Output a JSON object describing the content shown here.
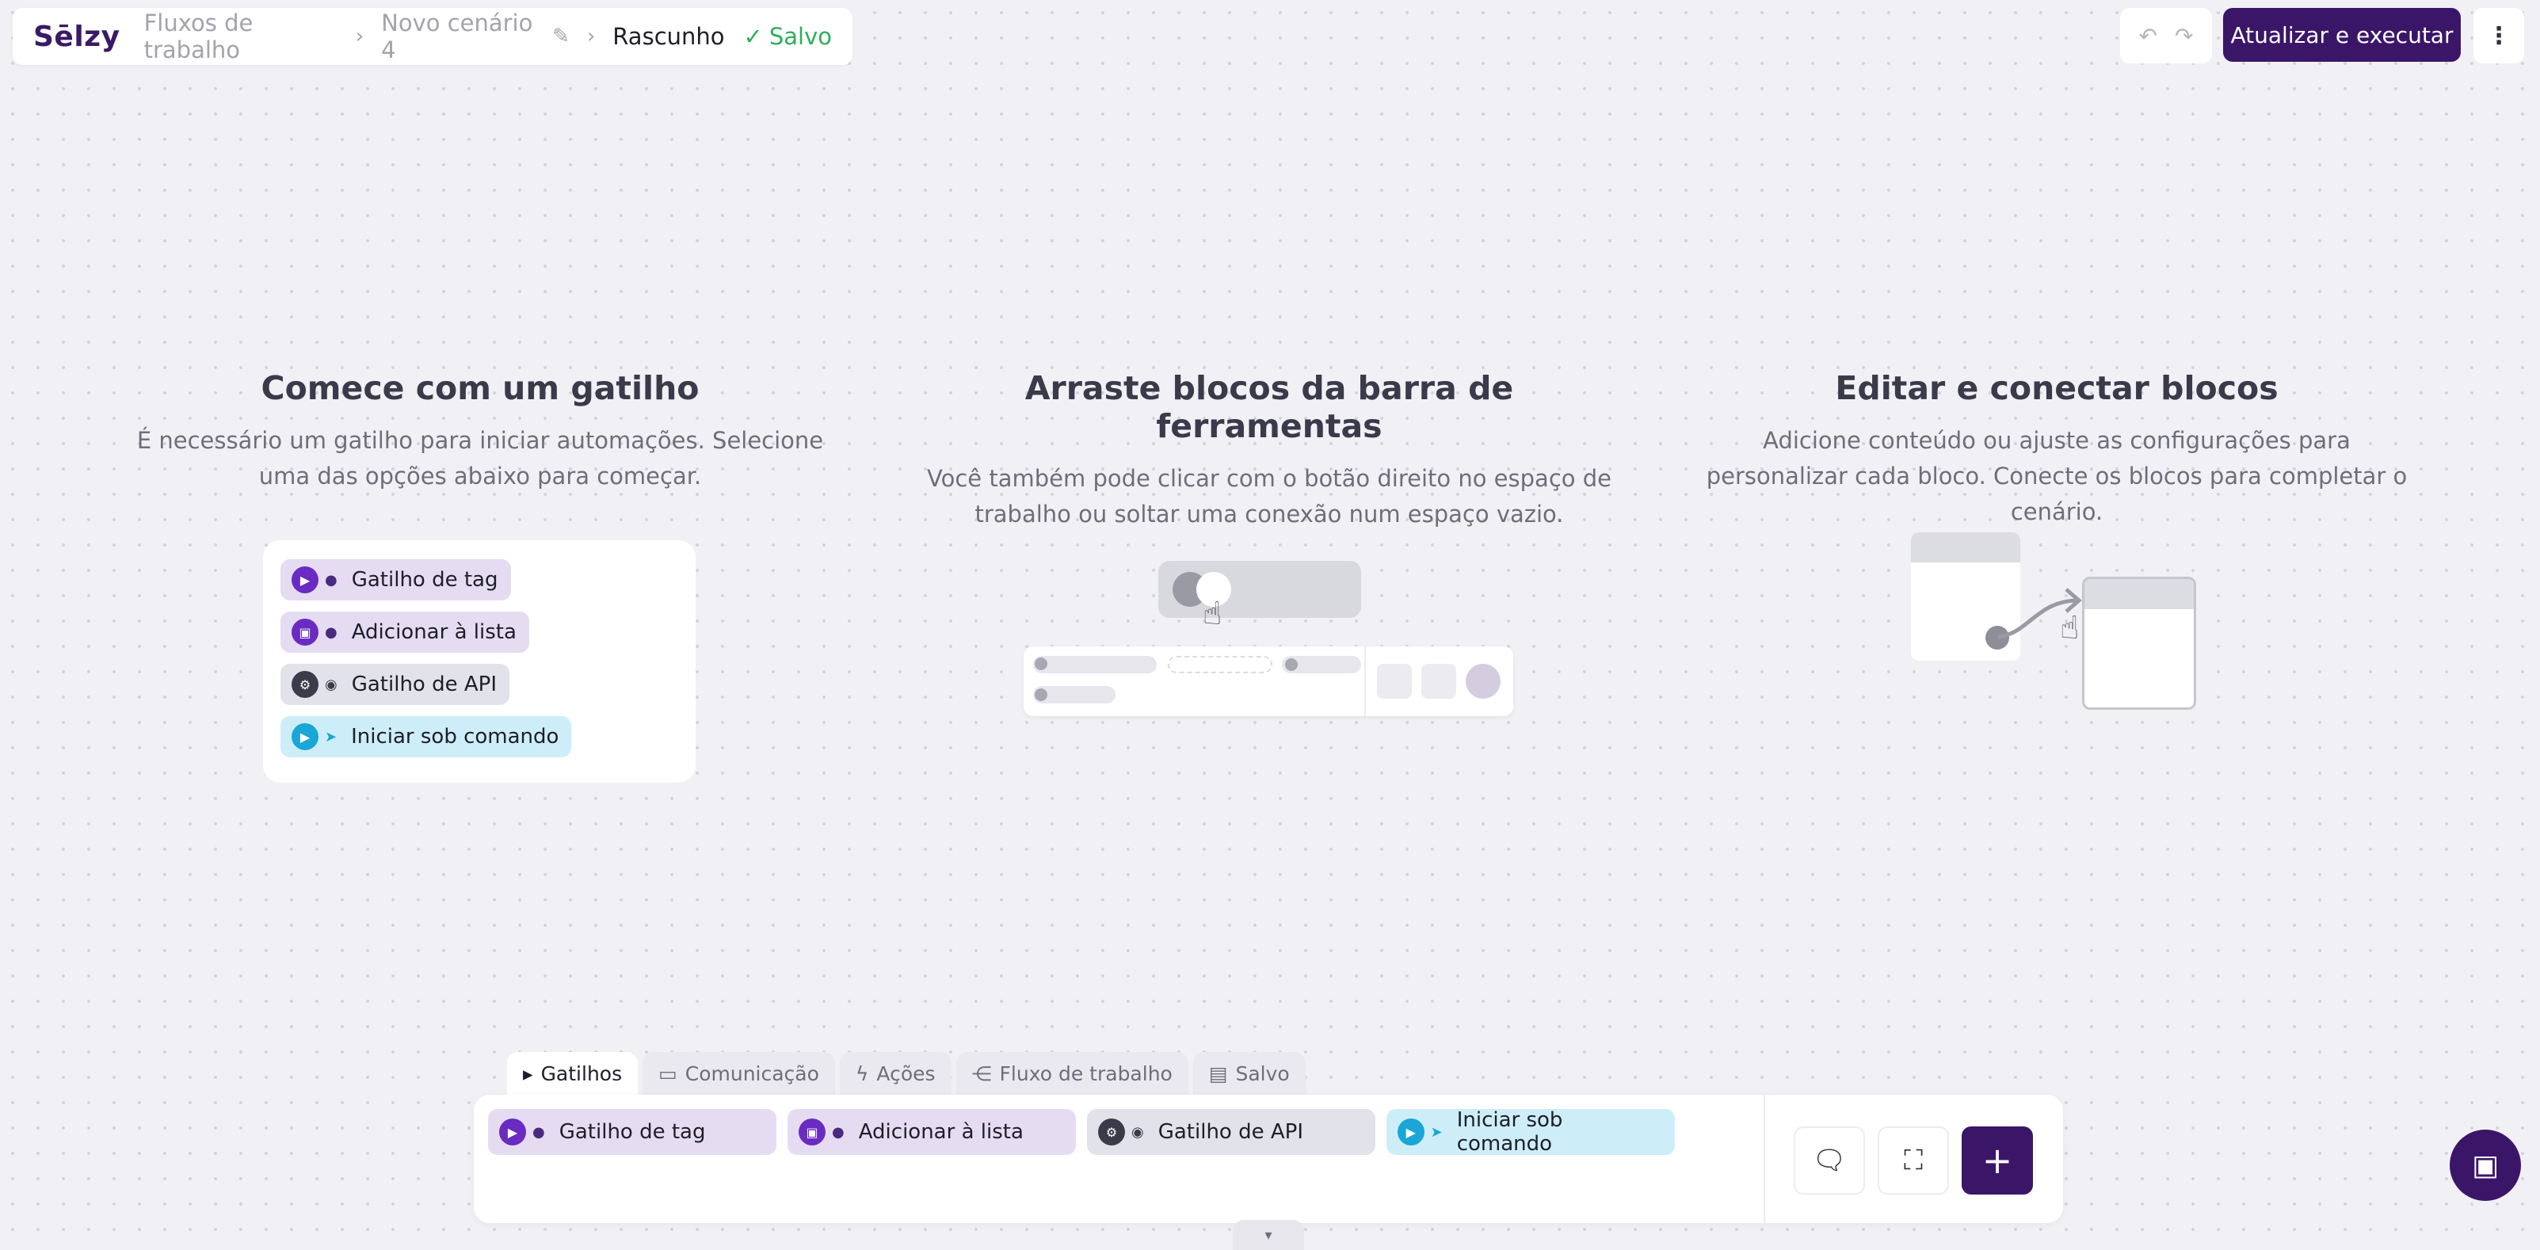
{
  "header": {
    "logo": "Sēlzy",
    "breadcrumbs": [
      "Fluxos de trabalho",
      "Novo cenário 4"
    ],
    "current": "Rascunho",
    "status": "Salvo",
    "run_label": "Atualizar e executar"
  },
  "intro": [
    {
      "title": "Comece com um gatilho",
      "text": "É necessário um gatilho para iniciar automações. Selecione uma das opções abaixo para começar."
    },
    {
      "title": "Arraste blocos da barra de ferramentas",
      "text": "Você também pode clicar com o botão direito no espaço de trabalho ou soltar uma conexão num espaço vazio."
    },
    {
      "title": "Editar e conectar blocos",
      "text": "Adicione conteúdo ou ajuste as configurações para personalizar cada bloco. Conecte os blocos para completar o cenário."
    }
  ],
  "triggers": [
    {
      "label": "Gatilho de tag",
      "icon": "tag-trigger-icon",
      "color": "#6a2bc2"
    },
    {
      "label": "Adicionar à lista",
      "icon": "add-to-list-icon",
      "color": "#6a2bc2"
    },
    {
      "label": "Gatilho de API",
      "icon": "api-trigger-icon",
      "color": "#3b3b4a"
    },
    {
      "label": "Iniciar sob comando",
      "icon": "start-command-icon",
      "color": "#1aa6d6"
    }
  ],
  "tabs": [
    {
      "label": "Gatilhos",
      "icon": "play-icon"
    },
    {
      "label": "Comunicação",
      "icon": "chat-icon"
    },
    {
      "label": "Ações",
      "icon": "bolt-icon"
    },
    {
      "label": "Fluxo de trabalho",
      "icon": "workflow-icon"
    },
    {
      "label": "Salvo",
      "icon": "save-icon"
    }
  ],
  "colors": {
    "brand": "#3b1668",
    "saved": "#2fae5a"
  }
}
